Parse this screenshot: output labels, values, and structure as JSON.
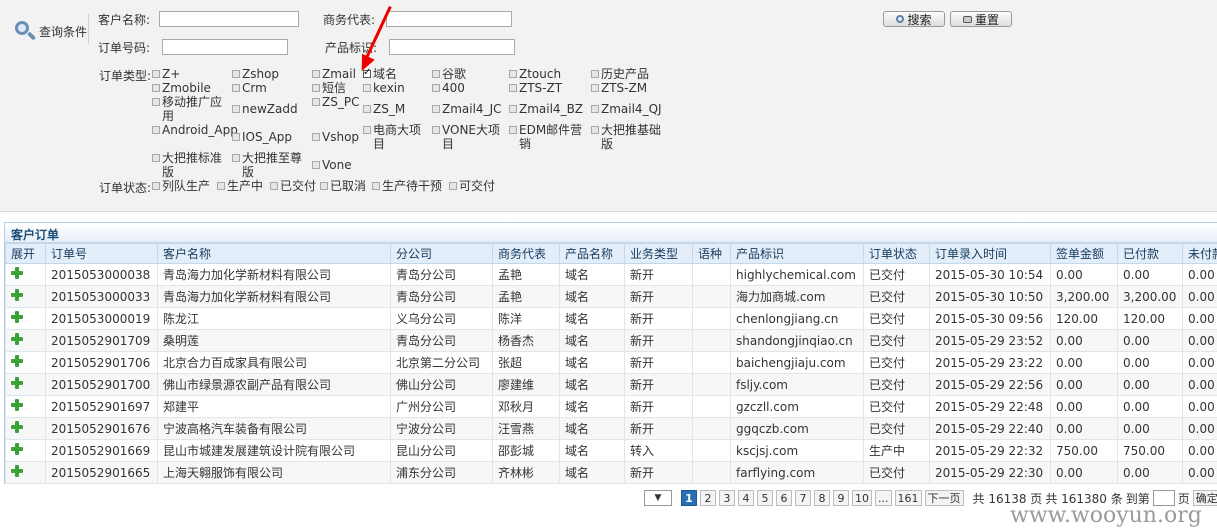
{
  "query": {
    "title": "查询条件",
    "customer_name_label": "客户名称:",
    "business_rep_label": "商务代表:",
    "order_no_label": "订单号码:",
    "product_id_label": "产品标识:",
    "search_label": "搜索",
    "reset_label": "重置",
    "order_type_label": "订单类型:",
    "order_status_label": "订单状态:",
    "order_types": [
      {
        "label": "Z+",
        "checked": false
      },
      {
        "label": "Zshop",
        "checked": false
      },
      {
        "label": "Zmail",
        "checked": false
      },
      {
        "label": "域名",
        "checked": true
      },
      {
        "label": "谷歌",
        "checked": false
      },
      {
        "label": "Ztouch",
        "checked": false
      },
      {
        "label": "历史产品",
        "checked": false
      },
      {
        "label": "Zmobile",
        "checked": false
      },
      {
        "label": "Crm",
        "checked": false
      },
      {
        "label": "短信",
        "checked": false
      },
      {
        "label": "kexin",
        "checked": false
      },
      {
        "label": "400",
        "checked": false
      },
      {
        "label": "ZTS-ZT",
        "checked": false
      },
      {
        "label": "ZTS-ZM",
        "checked": false
      },
      {
        "label": "移动推广应用",
        "checked": false
      },
      {
        "label": "newZadd",
        "checked": false
      },
      {
        "label": "ZS_PC",
        "checked": false
      },
      {
        "label": "ZS_M",
        "checked": false
      },
      {
        "label": "Zmail4_JC",
        "checked": false
      },
      {
        "label": "Zmail4_BZ",
        "checked": false
      },
      {
        "label": "Zmail4_QJ",
        "checked": false
      },
      {
        "label": "Android_App",
        "checked": false
      },
      {
        "label": "IOS_App",
        "checked": false
      },
      {
        "label": "Vshop",
        "checked": false
      },
      {
        "label": "电商大项目",
        "checked": false
      },
      {
        "label": "VONE大项目",
        "checked": false
      },
      {
        "label": "EDM邮件营销",
        "checked": false
      },
      {
        "label": "大把推基础版",
        "checked": false
      },
      {
        "label": "大把推标准版",
        "checked": false
      },
      {
        "label": "大把推至尊版",
        "checked": false
      },
      {
        "label": "Vone",
        "checked": false
      }
    ],
    "order_statuses": [
      {
        "label": "列队生产",
        "checked": false
      },
      {
        "label": "生产中",
        "checked": false
      },
      {
        "label": "已交付",
        "checked": false
      },
      {
        "label": "已取消",
        "checked": false
      },
      {
        "label": "生产待干预",
        "checked": false
      },
      {
        "label": "可交付",
        "checked": false
      }
    ]
  },
  "orders": {
    "title": "客户订单",
    "columns": [
      "展开",
      "订单号",
      "客户名称",
      "分公司",
      "商务代表",
      "产品名称",
      "业务类型",
      "语种",
      "产品标识",
      "订单状态",
      "订单录入时间",
      "签单金额",
      "已付款",
      "未付款"
    ],
    "rows": [
      [
        "2015053000038",
        "青岛海力加化学新材料有限公司",
        "青岛分公司",
        "孟艳",
        "域名",
        "新开",
        "",
        "highlychemical.com",
        "已交付",
        "2015-05-30 10:54",
        "0.00",
        "0.00",
        "0.00"
      ],
      [
        "2015053000033",
        "青岛海力加化学新材料有限公司",
        "青岛分公司",
        "孟艳",
        "域名",
        "新开",
        "",
        "海力加商城.com",
        "已交付",
        "2015-05-30 10:50",
        "3,200.00",
        "3,200.00",
        "0.00"
      ],
      [
        "2015053000019",
        "陈龙江",
        "义乌分公司",
        "陈洋",
        "域名",
        "新开",
        "",
        "chenlongjiang.cn",
        "已交付",
        "2015-05-30 09:56",
        "120.00",
        "120.00",
        "0.00"
      ],
      [
        "2015052901709",
        "桑明莲",
        "青岛分公司",
        "杨香杰",
        "域名",
        "新开",
        "",
        "shandongjinqiao.cn",
        "已交付",
        "2015-05-29 23:52",
        "0.00",
        "0.00",
        "0.00"
      ],
      [
        "2015052901706",
        "北京合力百成家具有限公司",
        "北京第二分公司",
        "张超",
        "域名",
        "新开",
        "",
        "baichengjiaju.com",
        "已交付",
        "2015-05-29 23:22",
        "0.00",
        "0.00",
        "0.00"
      ],
      [
        "2015052901700",
        "佛山市绿景源农副产品有限公司",
        "佛山分公司",
        "廖建维",
        "域名",
        "新开",
        "",
        "fsljy.com",
        "已交付",
        "2015-05-29 22:56",
        "0.00",
        "0.00",
        "0.00"
      ],
      [
        "2015052901697",
        "郑建平",
        "广州分公司",
        "邓秋月",
        "域名",
        "新开",
        "",
        "gzczll.com",
        "已交付",
        "2015-05-29 22:48",
        "0.00",
        "0.00",
        "0.00"
      ],
      [
        "2015052901676",
        "宁波高格汽车装备有限公司",
        "宁波分公司",
        "汪雪燕",
        "域名",
        "新开",
        "",
        "ggqczb.com",
        "已交付",
        "2015-05-29 22:40",
        "0.00",
        "0.00",
        "0.00"
      ],
      [
        "2015052901669",
        "昆山市城建发展建筑设计院有限公司",
        "昆山分公司",
        "邵彭城",
        "域名",
        "转入",
        "",
        "kscjsj.com",
        "生产中",
        "2015-05-29 22:32",
        "750.00",
        "750.00",
        "0.00"
      ],
      [
        "2015052901665",
        "上海天翱服饰有限公司",
        "浦东分公司",
        "齐林彬",
        "域名",
        "新开",
        "",
        "farflying.com",
        "已交付",
        "2015-05-29 22:30",
        "0.00",
        "0.00",
        "0.00"
      ]
    ]
  },
  "pager": {
    "select_symbol": "▼",
    "pages": [
      "1",
      "2",
      "3",
      "4",
      "5",
      "6",
      "7",
      "8",
      "9",
      "10",
      "...",
      "161"
    ],
    "active_page": "1",
    "next_label": "下一页",
    "total_records_text": "共 16138 页",
    "total_pages_text": "共 161380 条",
    "goto_label": "到第",
    "goto_unit": "页",
    "confirm_label": "确定"
  },
  "watermark": "www.wooyun.org"
}
